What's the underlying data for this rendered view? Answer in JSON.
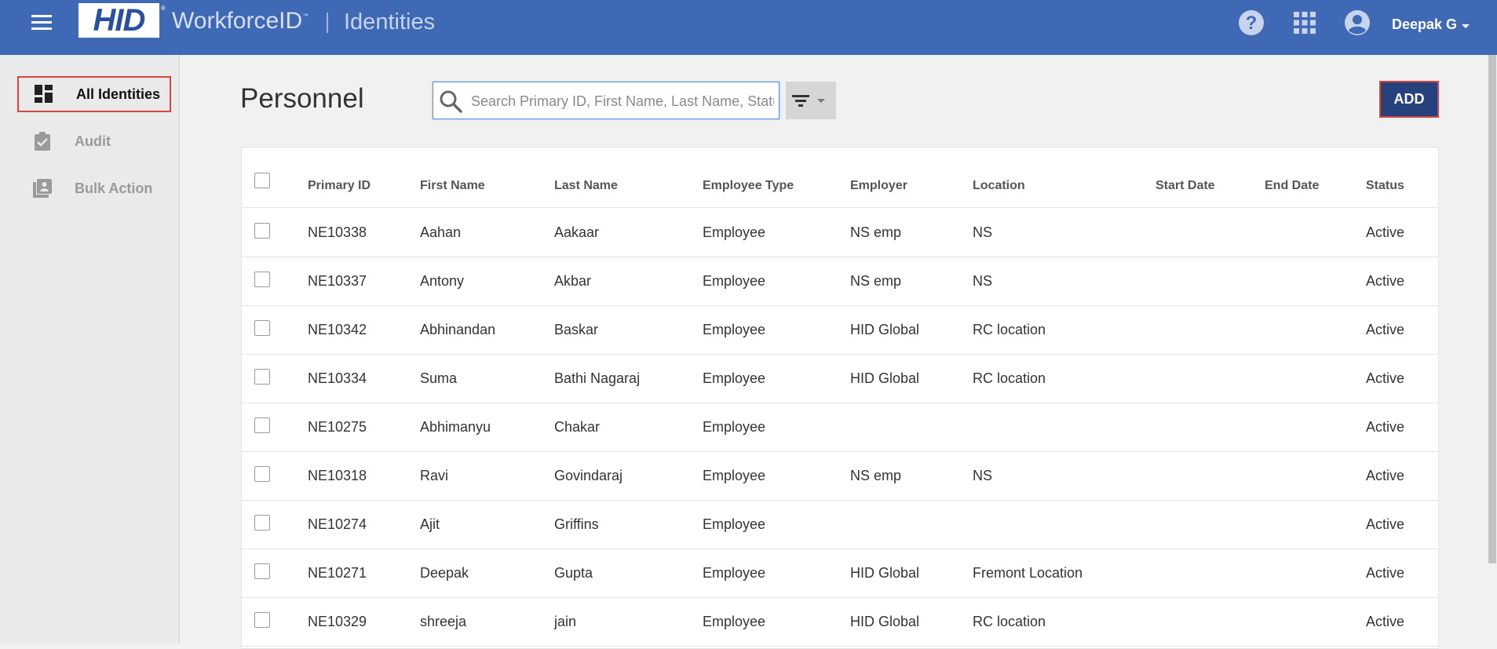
{
  "header": {
    "logo": "HID",
    "logo_reg": "®",
    "product": "WorkforceID",
    "product_tm": "™",
    "module": "Identities",
    "user_name": "Deepak G",
    "icons": [
      "menu-icon",
      "help-icon",
      "apps-grid-icon",
      "account-icon",
      "caret-down-icon"
    ],
    "color_bg": "#3f69b5"
  },
  "sidebar": {
    "items": [
      {
        "label": "All Identities",
        "icon": "dashboard-icon",
        "active": true
      },
      {
        "label": "Audit",
        "icon": "clipboard-check-icon",
        "active": false
      },
      {
        "label": "Bulk Action",
        "icon": "user-list-icon",
        "active": false
      }
    ]
  },
  "main": {
    "title": "Personnel",
    "search_placeholder": "Search Primary ID, First Name, Last Name, Status",
    "add_label": "ADD",
    "accent": "#27417c"
  },
  "table": {
    "columns": [
      "Primary ID",
      "First Name",
      "Last Name",
      "Employee Type",
      "Employer",
      "Location",
      "Start Date",
      "End Date",
      "Status"
    ],
    "rows": [
      [
        "NE10338",
        "Aahan",
        "Aakaar",
        "Employee",
        "NS emp",
        "NS",
        "",
        "",
        "Active"
      ],
      [
        "NE10337",
        "Antony",
        "Akbar",
        "Employee",
        "NS emp",
        "NS",
        "",
        "",
        "Active"
      ],
      [
        "NE10342",
        "Abhinandan",
        "Baskar",
        "Employee",
        "HID Global",
        "RC location",
        "",
        "",
        "Active"
      ],
      [
        "NE10334",
        "Suma",
        "Bathi Nagaraj",
        "Employee",
        "HID Global",
        "RC location",
        "",
        "",
        "Active"
      ],
      [
        "NE10275",
        "Abhimanyu",
        "Chakar",
        "Employee",
        "",
        "",
        "",
        "",
        "Active"
      ],
      [
        "NE10318",
        "Ravi",
        "Govindaraj",
        "Employee",
        "NS emp",
        "NS",
        "",
        "",
        "Active"
      ],
      [
        "NE10274",
        "Ajit",
        "Griffins",
        "Employee",
        "",
        "",
        "",
        "",
        "Active"
      ],
      [
        "NE10271",
        "Deepak",
        "Gupta",
        "Employee",
        "HID Global",
        "Fremont Location",
        "",
        "",
        "Active"
      ],
      [
        "NE10329",
        "shreeja",
        "jain",
        "Employee",
        "HID Global",
        "RC location",
        "",
        "",
        "Active"
      ]
    ]
  }
}
